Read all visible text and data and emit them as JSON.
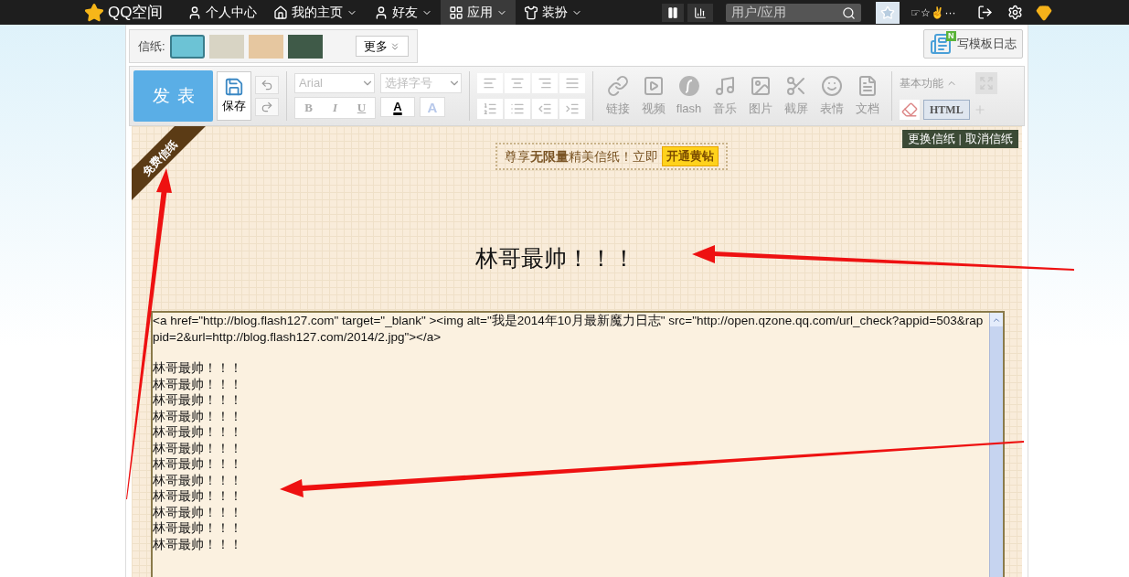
{
  "top_bar": {
    "logo": "QQ空间",
    "nav": [
      {
        "label": "个人中心",
        "dropdown": false,
        "selected": false
      },
      {
        "label": "我的主页",
        "dropdown": true,
        "selected": false
      },
      {
        "label": "好友",
        "dropdown": true,
        "selected": false
      },
      {
        "label": "应用",
        "dropdown": true,
        "selected": true
      },
      {
        "label": "装扮",
        "dropdown": true,
        "selected": false
      }
    ],
    "search": {
      "placeholder": "用户/应用"
    },
    "user_name": "☞☆✌···"
  },
  "stationery": {
    "label": "信纸:",
    "thumbnails": [
      {
        "selected": true
      },
      {
        "selected": false
      },
      {
        "selected": false
      },
      {
        "selected": false
      }
    ],
    "more": "更多"
  },
  "template_button": {
    "label": "写模板日志",
    "badge": "N"
  },
  "toolbar": {
    "publish": "发表",
    "save": "保存",
    "font": "Arial",
    "font_size": "选择字号",
    "format": [
      "B",
      "I",
      "U"
    ],
    "color_button": "A",
    "effect_button": "A",
    "insert": [
      {
        "kind": "link",
        "label": "链接"
      },
      {
        "kind": "video",
        "label": "视频"
      },
      {
        "kind": "flash",
        "label": "flash"
      },
      {
        "kind": "music",
        "label": "音乐"
      },
      {
        "kind": "image",
        "label": "图片"
      },
      {
        "kind": "screenshot",
        "label": "截屏"
      },
      {
        "kind": "emoji",
        "label": "表情"
      },
      {
        "kind": "document",
        "label": "文档"
      }
    ],
    "basic": "基本功能",
    "html": {
      "label": "HTML",
      "selected": true
    }
  },
  "editor": {
    "ribbon": "免费信纸",
    "promo": {
      "text": "尊享**无限量**精美信纸！立即",
      "button": "开通黄钻"
    },
    "paper_links": [
      "更换信纸",
      "取消信纸"
    ],
    "paper_links_separator": "|",
    "heading": "林哥最帅！！！",
    "source_code": "<a href=\"http://blog.flash127.com\" target=\"_blank\" ><img alt=\"我是2014年10月最新魔力日志\" src=\"http://open.qzone.qq.com/url_check?appid=503&rappid=2&url=http://blog.flash127.com/2014/2.jpg\"></a>",
    "source_lines": [
      "林哥最帅！！！",
      "林哥最帅！！！",
      "林哥最帅！！！",
      "林哥最帅！！！",
      "林哥最帅！！！",
      "林哥最帅！！！",
      "林哥最帅！！！",
      "林哥最帅！！！",
      "林哥最帅！！！",
      "林哥最帅！！！",
      "林哥最帅！！！",
      "林哥最帅！！！"
    ]
  }
}
